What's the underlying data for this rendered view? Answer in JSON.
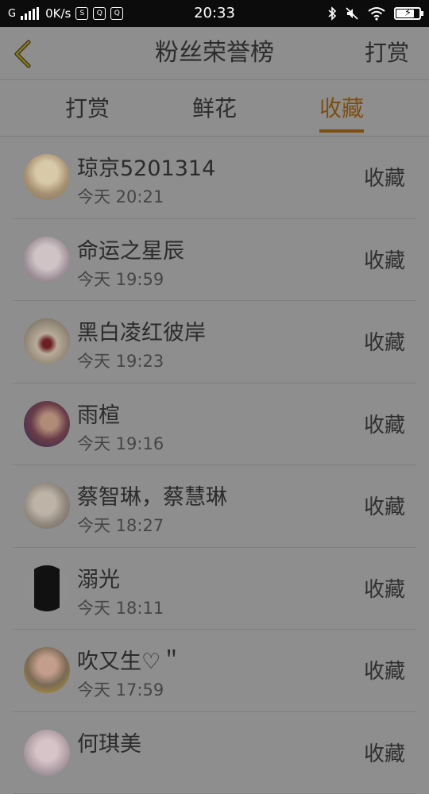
{
  "status_bar": {
    "carrier": "G",
    "net_speed": "0K/s",
    "time": "20:33"
  },
  "header": {
    "back_icon": "chevron-left-icon",
    "title": "粉丝荣誉榜",
    "action": "打赏"
  },
  "tabs": [
    {
      "label": "打赏",
      "active": false
    },
    {
      "label": "鲜花",
      "active": false
    },
    {
      "label": "收藏",
      "active": true
    }
  ],
  "colors": {
    "accent": "#7d4f0f",
    "background": "#8e8e8e",
    "status_bar": "#0c0c0c"
  },
  "list": [
    {
      "name": "琼京5201314",
      "time": "今天 20:21",
      "action": "收藏"
    },
    {
      "name": "命运之星辰",
      "time": "今天 19:59",
      "action": "收藏"
    },
    {
      "name": "黑白凌红彼岸",
      "time": "今天 19:23",
      "action": "收藏"
    },
    {
      "name": "雨楦",
      "time": "今天 19:16",
      "action": "收藏"
    },
    {
      "name": "蔡智琳，蔡慧琳",
      "time": "今天 18:27",
      "action": "收藏"
    },
    {
      "name": "溺光",
      "time": "今天 18:11",
      "action": "收藏"
    },
    {
      "name": "吹又生♡＂",
      "time": "今天 17:59",
      "action": "收藏"
    },
    {
      "name": "何琪美",
      "time": "",
      "action": "收藏"
    }
  ]
}
